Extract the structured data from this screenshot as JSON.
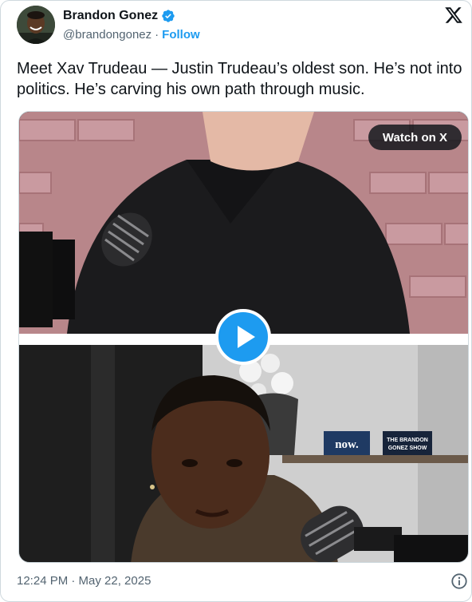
{
  "author": {
    "display_name": "Brandon Gonez",
    "handle": "@brandongonez",
    "separator": "·",
    "follow_label": "Follow",
    "verified_icon": "verified-badge-icon"
  },
  "tweet": {
    "text": "Meet Xav Trudeau — Justin Trudeau’s oldest son. He’s not into politics. He’s carving his own path through music."
  },
  "media": {
    "watch_label": "Watch on X",
    "play_icon": "play-icon",
    "sign_now": "now.",
    "sign_show_1": "THE BRANDON",
    "sign_show_2": "GONEZ SHOW",
    "mic_brand": "THE BRANDON GONEZ SHOW"
  },
  "footer": {
    "timestamp": "12:24 PM · May 22, 2025",
    "info_icon": "info-icon"
  },
  "colors": {
    "accent": "#1d9bf0",
    "text": "#0f1419",
    "secondary": "#536471"
  }
}
